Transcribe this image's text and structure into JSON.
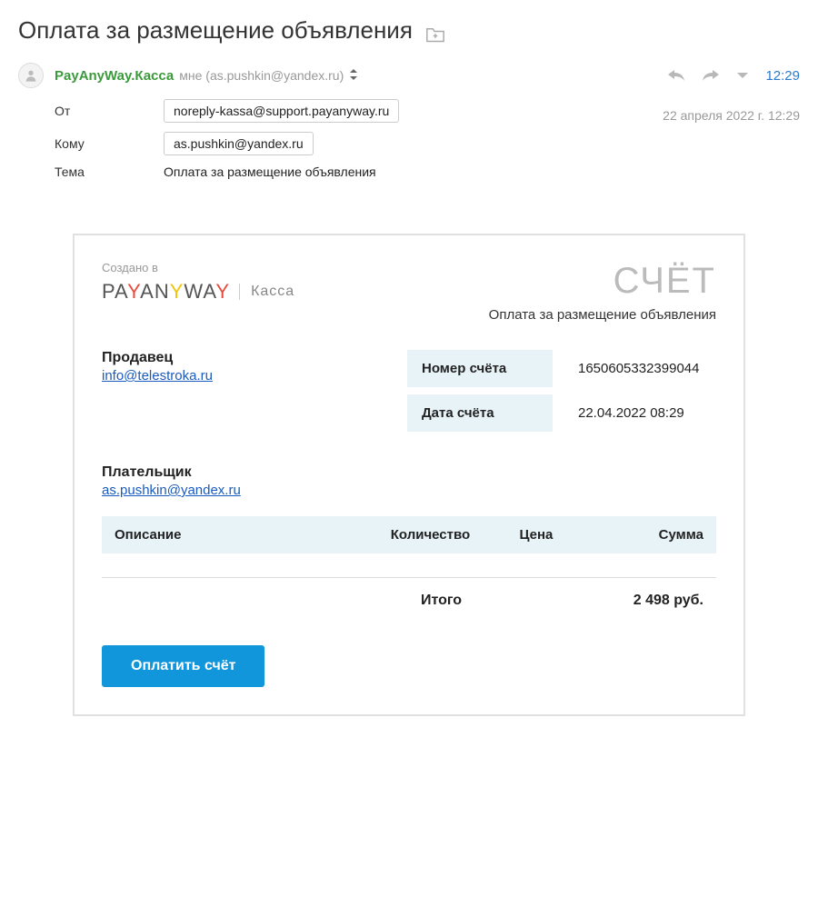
{
  "page": {
    "title": "Оплата за размещение объявления"
  },
  "email": {
    "sender_name": "PayAnyWay.Касса",
    "recipient_summary": "мне (as.pushkin@yandex.ru)",
    "time": "12:29",
    "full_date": "22 апреля 2022 г.  12:29",
    "fields": {
      "from_label": "От",
      "from_value": "noreply-kassa@support.payanyway.ru",
      "to_label": "Кому",
      "to_value": "as.pushkin@yandex.ru",
      "subject_label": "Тема",
      "subject_value": "Оплата за размещение объявления"
    }
  },
  "invoice": {
    "created_in": "Создано в",
    "brand_plain1": "PA",
    "brand_y1": "Y",
    "brand_plain2": "AN",
    "brand_y2": "Y",
    "brand_plain3": "WA",
    "brand_y3": "Y",
    "brand_sub": "Касса",
    "title": "СЧЁТ",
    "subtitle": "Оплата за размещение объявления",
    "seller_label": "Продавец",
    "seller_email": "info@telestroka.ru",
    "meta": {
      "number_label": "Номер счёта",
      "number_value": "1650605332399044",
      "date_label": "Дата счёта",
      "date_value": "22.04.2022 08:29"
    },
    "payer_label": "Плательщик",
    "payer_email": "as.pushkin@yandex.ru",
    "columns": {
      "desc": "Описание",
      "qty": "Количество",
      "price": "Цена",
      "sum": "Сумма"
    },
    "total_label": "Итого",
    "total_value": "2 498 руб.",
    "pay_button": "Оплатить счёт"
  }
}
